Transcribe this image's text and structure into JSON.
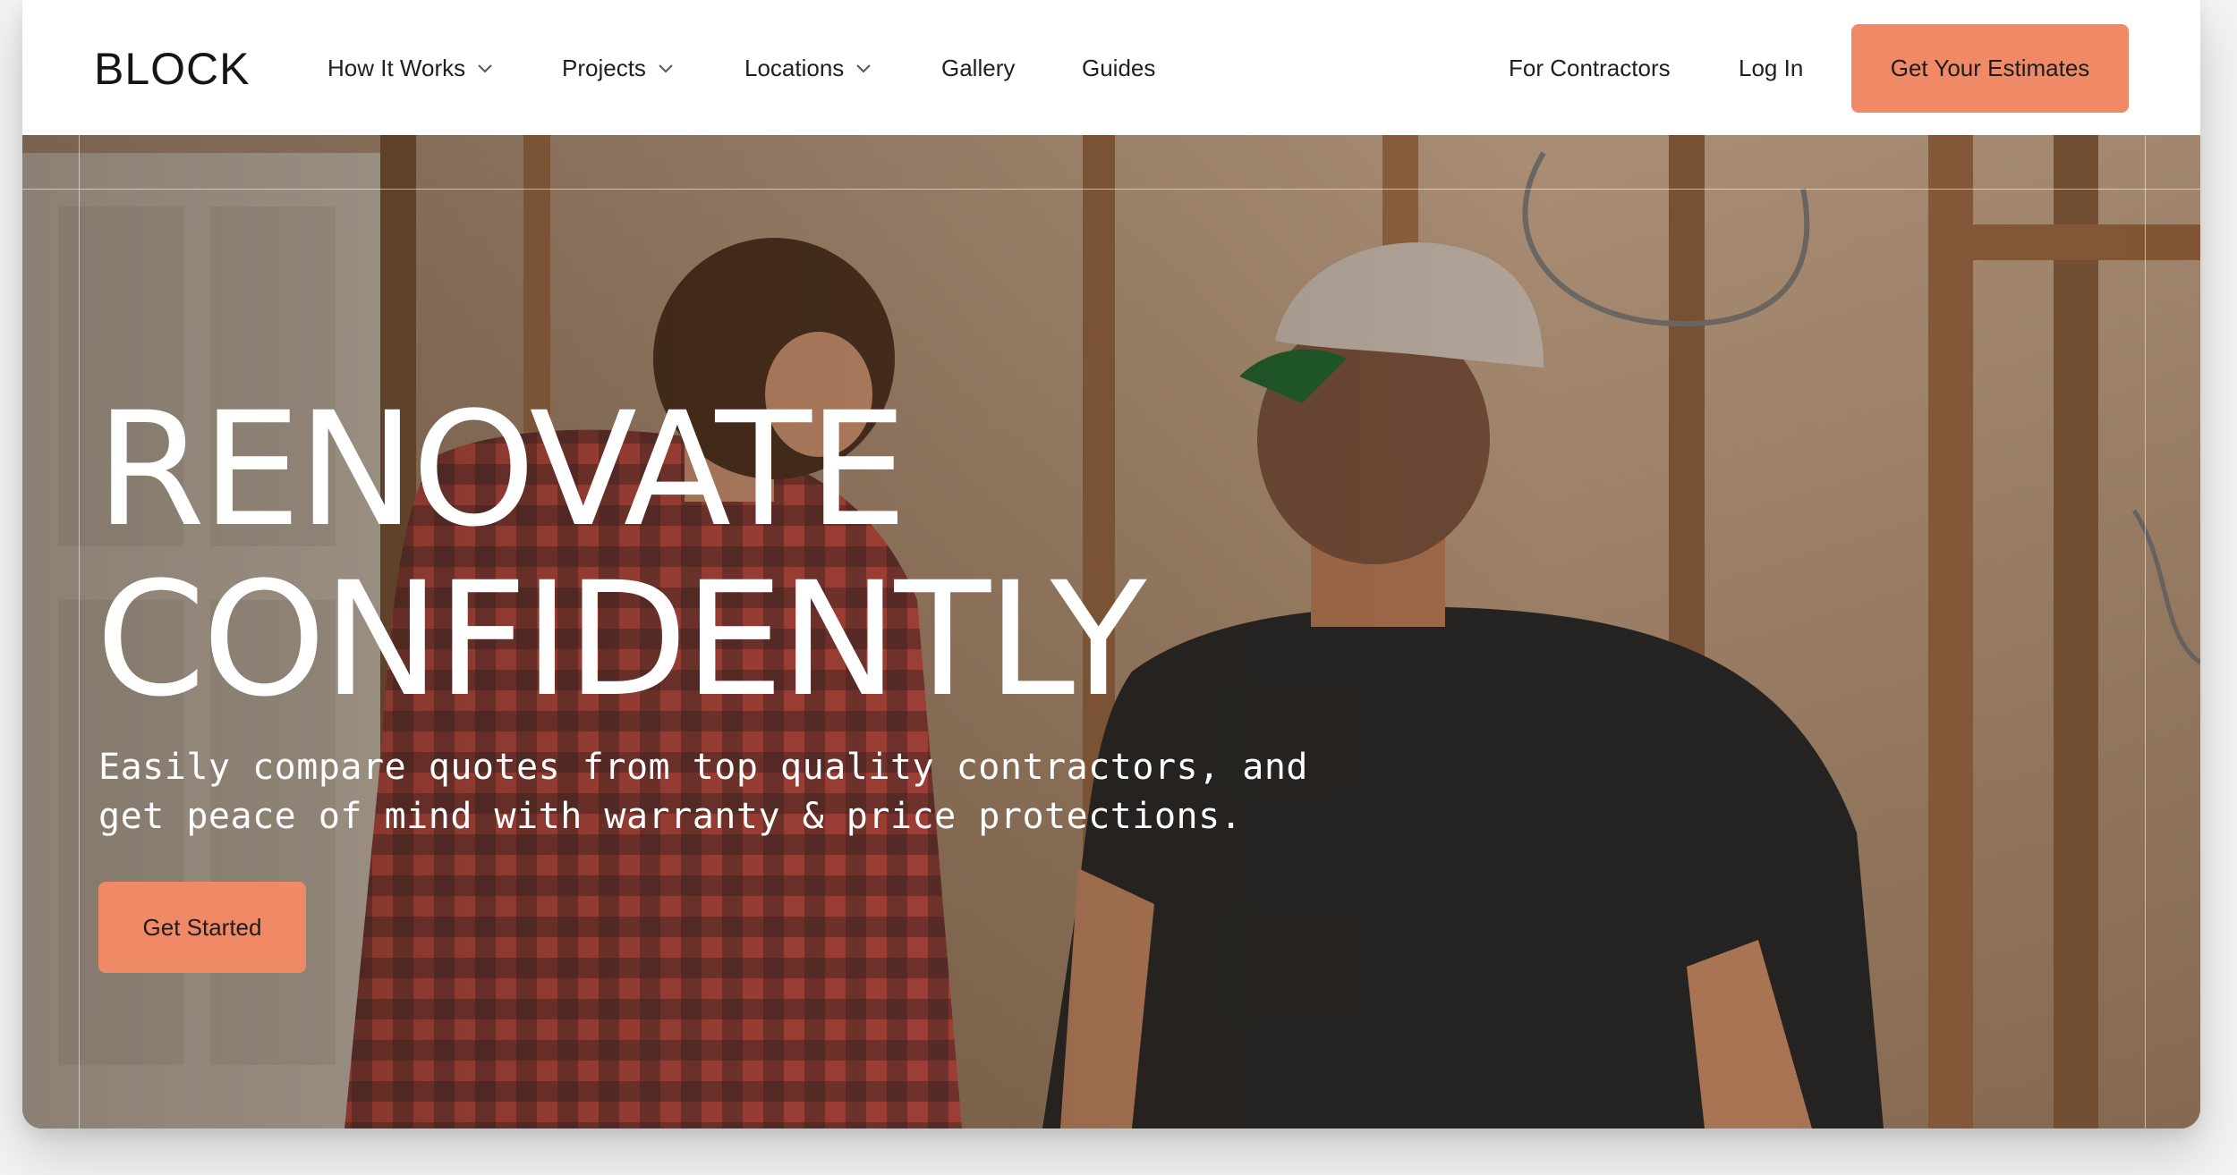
{
  "brand": {
    "logo_text": "BLOCK"
  },
  "nav": {
    "items": [
      {
        "label": "How It Works",
        "has_dropdown": true
      },
      {
        "label": "Projects",
        "has_dropdown": true
      },
      {
        "label": "Locations",
        "has_dropdown": true
      },
      {
        "label": "Gallery",
        "has_dropdown": false
      },
      {
        "label": "Guides",
        "has_dropdown": false
      }
    ],
    "right": {
      "contractors_label": "For Contractors",
      "login_label": "Log In",
      "cta_label": "Get Your Estimates"
    }
  },
  "hero": {
    "headline_line1": "RENOVATE",
    "headline_line2": "CONFIDENTLY",
    "subtext": "Easily compare quotes from top quality contractors, and get peace of mind with warranty & price protections.",
    "cta_label": "Get Started",
    "image_semantic": "two-contractors-renovation-photo"
  },
  "colors": {
    "accent": "#f08a66",
    "nav_bg": "#ffffff",
    "text_dark": "#202020",
    "hero_text": "#ffffff"
  }
}
